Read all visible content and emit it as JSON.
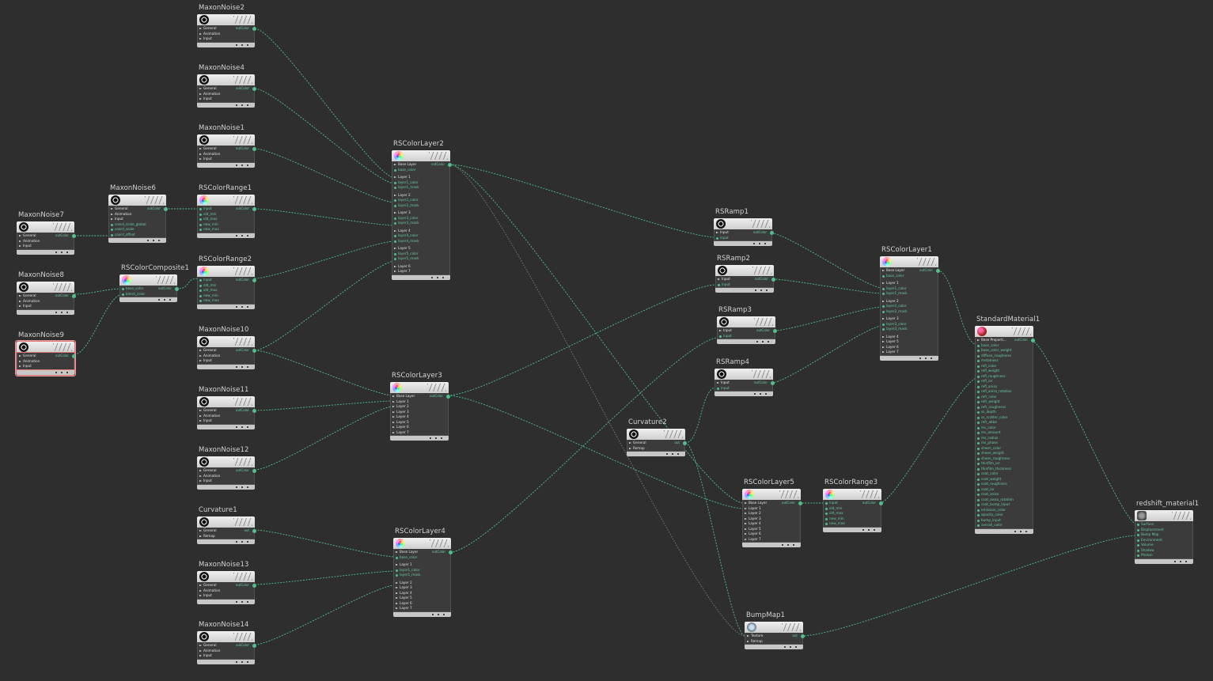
{
  "colors": {
    "wire": "#4fbf8d",
    "wire_dim": "#7a7a7a",
    "node_head": "#dcdcdc",
    "node_body": "#3b3b3b",
    "selected": "#e59a9a",
    "canvas": "#2e2e2e"
  },
  "nodes": [
    {
      "id": "MaxonNoise2",
      "title": "MaxonNoise2",
      "icon": "noise-icon",
      "rows": [
        [
          "g",
          "General"
        ],
        [
          "g",
          "Animation"
        ],
        [
          "g",
          "Input"
        ]
      ],
      "out": "outColor"
    },
    {
      "id": "MaxonNoise4",
      "title": "MaxonNoise4",
      "icon": "noise-icon",
      "rows": [
        [
          "g",
          "General"
        ],
        [
          "g",
          "Animation"
        ],
        [
          "g",
          "Input"
        ]
      ],
      "out": "outColor"
    },
    {
      "id": "MaxonNoise1",
      "title": "MaxonNoise1",
      "icon": "noise-icon",
      "rows": [
        [
          "g",
          "General"
        ],
        [
          "g",
          "Animation"
        ],
        [
          "g",
          "Input"
        ]
      ],
      "out": "outColor"
    },
    {
      "id": "MaxonNoise6",
      "title": "MaxonNoise6",
      "icon": "noise-icon",
      "rows": [
        [
          "g",
          "General"
        ],
        [
          "g",
          "Animation"
        ],
        [
          "g",
          "Input"
        ],
        [
          "p",
          "coord_scale_global"
        ],
        [
          "p",
          "coord_scale"
        ],
        [
          "p",
          "coord_offset"
        ]
      ],
      "out": "outColor"
    },
    {
      "id": "MaxonNoise7",
      "title": "MaxonNoise7",
      "icon": "noise-icon",
      "rows": [
        [
          "g",
          "General"
        ],
        [
          "g",
          "Animation"
        ],
        [
          "g",
          "Input"
        ]
      ],
      "out": "outColor"
    },
    {
      "id": "MaxonNoise8",
      "title": "MaxonNoise8",
      "icon": "noise-icon",
      "rows": [
        [
          "g",
          "General"
        ],
        [
          "g",
          "Animation"
        ],
        [
          "g",
          "Input"
        ]
      ],
      "out": "outColor"
    },
    {
      "id": "MaxonNoise9",
      "title": "MaxonNoise9",
      "icon": "noise-icon",
      "rows": [
        [
          "g",
          "General"
        ],
        [
          "g",
          "Animation"
        ],
        [
          "g",
          "Input"
        ]
      ],
      "out": "outColor",
      "selected": true
    },
    {
      "id": "RSColorRange1",
      "title": "RSColorRange1",
      "icon": "color-icon",
      "rows": [
        [
          "p",
          "input"
        ],
        [
          "p",
          "old_min"
        ],
        [
          "p",
          "old_max"
        ],
        [
          "p",
          "new_min"
        ],
        [
          "p",
          "new_max"
        ]
      ],
      "out": "outColor"
    },
    {
      "id": "RSColorComposite1",
      "title": "RSColorComposite1",
      "icon": "color-icon",
      "rows": [
        [
          "p",
          "base_color"
        ],
        [
          "p",
          "blend_color"
        ]
      ],
      "out": "outColor"
    },
    {
      "id": "RSColorRange2",
      "title": "RSColorRange2",
      "icon": "color-icon",
      "rows": [
        [
          "p",
          "input"
        ],
        [
          "p",
          "old_min"
        ],
        [
          "p",
          "old_max"
        ],
        [
          "p",
          "new_min"
        ],
        [
          "p",
          "new_max"
        ]
      ],
      "out": "outColor"
    },
    {
      "id": "MaxonNoise10",
      "title": "MaxonNoise10",
      "icon": "noise-icon",
      "rows": [
        [
          "g",
          "General"
        ],
        [
          "g",
          "Animation"
        ],
        [
          "g",
          "Input"
        ]
      ],
      "out": "outColor"
    },
    {
      "id": "MaxonNoise11",
      "title": "MaxonNoise11",
      "icon": "noise-icon",
      "rows": [
        [
          "g",
          "General"
        ],
        [
          "g",
          "Animation"
        ],
        [
          "g",
          "Input"
        ]
      ],
      "out": "outColor"
    },
    {
      "id": "MaxonNoise12",
      "title": "MaxonNoise12",
      "icon": "noise-icon",
      "rows": [
        [
          "g",
          "General"
        ],
        [
          "g",
          "Animation"
        ],
        [
          "g",
          "Input"
        ]
      ],
      "out": "outColor"
    },
    {
      "id": "Curvature1",
      "title": "Curvature1",
      "icon": "noise-icon",
      "rows": [
        [
          "g",
          "General"
        ],
        [
          "g",
          "Remap"
        ]
      ],
      "out": "out"
    },
    {
      "id": "MaxonNoise13",
      "title": "MaxonNoise13",
      "icon": "noise-icon",
      "rows": [
        [
          "g",
          "General"
        ],
        [
          "g",
          "Animation"
        ],
        [
          "g",
          "Input"
        ]
      ],
      "out": "outColor"
    },
    {
      "id": "MaxonNoise14",
      "title": "MaxonNoise14",
      "icon": "noise-icon",
      "rows": [
        [
          "g",
          "General"
        ],
        [
          "g",
          "Animation"
        ],
        [
          "g",
          "Input"
        ]
      ],
      "out": "outColor"
    },
    {
      "id": "RSColorLayer2",
      "title": "RSColorLayer2",
      "icon": "color-icon",
      "rows": [
        [
          "g",
          "Base Layer"
        ],
        [
          "p",
          "base_color"
        ],
        [
          "s",
          ""
        ],
        [
          "g",
          "Layer 1"
        ],
        [
          "p",
          "layer1_color"
        ],
        [
          "p",
          "layer1_mask"
        ],
        [
          "s",
          ""
        ],
        [
          "g",
          "Layer 2"
        ],
        [
          "p",
          "layer2_color"
        ],
        [
          "p",
          "layer2_mask"
        ],
        [
          "s",
          ""
        ],
        [
          "g",
          "Layer 3"
        ],
        [
          "p",
          "layer3_color"
        ],
        [
          "p",
          "layer3_mask"
        ],
        [
          "s",
          ""
        ],
        [
          "g",
          "Layer 4"
        ],
        [
          "p",
          "layer4_color"
        ],
        [
          "p",
          "layer4_mask"
        ],
        [
          "s",
          ""
        ],
        [
          "g",
          "Layer 5"
        ],
        [
          "p",
          "layer5_color"
        ],
        [
          "p",
          "layer5_mask"
        ],
        [
          "s",
          ""
        ],
        [
          "g",
          "Layer 6"
        ],
        [
          "g",
          "Layer 7"
        ]
      ],
      "out": "outColor"
    },
    {
      "id": "RSColorLayer3",
      "title": "RSColorLayer3",
      "icon": "color-icon",
      "rows": [
        [
          "g",
          "Base Layer"
        ],
        [
          "g",
          "Layer 1"
        ],
        [
          "g",
          "Layer 2"
        ],
        [
          "g",
          "Layer 3"
        ],
        [
          "g",
          "Layer 4"
        ],
        [
          "g",
          "Layer 5"
        ],
        [
          "g",
          "Layer 6"
        ],
        [
          "g",
          "Layer 7"
        ]
      ],
      "out": "outColor"
    },
    {
      "id": "RSColorLayer4",
      "title": "RSColorLayer4",
      "icon": "color-icon",
      "rows": [
        [
          "g",
          "Base Layer"
        ],
        [
          "p",
          "base_color"
        ],
        [
          "s",
          ""
        ],
        [
          "g",
          "Layer 1"
        ],
        [
          "p",
          "layer1_color"
        ],
        [
          "p",
          "layer1_mask"
        ],
        [
          "s",
          ""
        ],
        [
          "g",
          "Layer 2"
        ],
        [
          "g",
          "Layer 3"
        ],
        [
          "g",
          "Layer 4"
        ],
        [
          "g",
          "Layer 5"
        ],
        [
          "g",
          "Layer 6"
        ],
        [
          "g",
          "Layer 7"
        ]
      ],
      "out": "outColor"
    },
    {
      "id": "RSRamp1",
      "title": "RSRamp1",
      "icon": "noise-icon",
      "rows": [
        [
          "g",
          "Input"
        ],
        [
          "p",
          "input"
        ]
      ],
      "out": "outColor"
    },
    {
      "id": "RSRamp2",
      "title": "RSRamp2",
      "icon": "noise-icon",
      "rows": [
        [
          "g",
          "Input"
        ],
        [
          "p",
          "input"
        ]
      ],
      "out": "outColor"
    },
    {
      "id": "RSRamp3",
      "title": "RSRamp3",
      "icon": "noise-icon",
      "rows": [
        [
          "g",
          "Input"
        ],
        [
          "p",
          "input"
        ]
      ],
      "out": "outColor"
    },
    {
      "id": "RSRamp4",
      "title": "RSRamp4",
      "icon": "noise-icon",
      "rows": [
        [
          "g",
          "Input"
        ],
        [
          "p",
          "input"
        ]
      ],
      "out": "outColor"
    },
    {
      "id": "Curvature2",
      "title": "Curvature2",
      "icon": "noise-icon",
      "rows": [
        [
          "g",
          "General"
        ],
        [
          "g",
          "Remap"
        ]
      ],
      "out": "out"
    },
    {
      "id": "RSColorLayer5",
      "title": "RSColorLayer5",
      "icon": "color-icon",
      "rows": [
        [
          "g",
          "Base Layer"
        ],
        [
          "g",
          "Layer 1"
        ],
        [
          "g",
          "Layer 2"
        ],
        [
          "g",
          "Layer 3"
        ],
        [
          "g",
          "Layer 4"
        ],
        [
          "g",
          "Layer 5"
        ],
        [
          "g",
          "Layer 6"
        ],
        [
          "g",
          "Layer 7"
        ]
      ],
      "out": "outColor"
    },
    {
      "id": "RSColorRange3",
      "title": "RSColorRange3",
      "icon": "color-icon",
      "rows": [
        [
          "p",
          "input"
        ],
        [
          "p",
          "old_min"
        ],
        [
          "p",
          "old_max"
        ],
        [
          "p",
          "new_min"
        ],
        [
          "p",
          "new_max"
        ]
      ],
      "out": "outColor"
    },
    {
      "id": "BumpMap1",
      "title": "BumpMap1",
      "icon": "bump-icon",
      "rows": [
        [
          "g",
          "Texture"
        ],
        [
          "g",
          "Remap"
        ]
      ],
      "out": "out"
    },
    {
      "id": "RSColorLayer1",
      "title": "RSColorLayer1",
      "icon": "color-icon",
      "rows": [
        [
          "g",
          "Base Layer"
        ],
        [
          "p",
          "base_color"
        ],
        [
          "s",
          ""
        ],
        [
          "g",
          "Layer 1"
        ],
        [
          "p",
          "layer1_color"
        ],
        [
          "p",
          "layer1_mask"
        ],
        [
          "s",
          ""
        ],
        [
          "g",
          "Layer 2"
        ],
        [
          "p",
          "layer2_color"
        ],
        [
          "p",
          "layer2_mask"
        ],
        [
          "s",
          ""
        ],
        [
          "g",
          "Layer 3"
        ],
        [
          "p",
          "layer3_color"
        ],
        [
          "p",
          "layer3_mask"
        ],
        [
          "s",
          ""
        ],
        [
          "g",
          "Layer 4"
        ],
        [
          "g",
          "Layer 5"
        ],
        [
          "g",
          "Layer 6"
        ],
        [
          "g",
          "Layer 7"
        ]
      ],
      "out": "outColor"
    },
    {
      "id": "StandardMaterial1",
      "title": "StandardMaterial1",
      "icon": "material-icon",
      "rows": [
        [
          "g",
          "Base Properti..."
        ],
        [
          "p",
          "base_color"
        ],
        [
          "p",
          "base_color_weight"
        ],
        [
          "p",
          "diffuse_roughness"
        ],
        [
          "p",
          "metalness"
        ],
        [
          "p",
          "refl_color"
        ],
        [
          "p",
          "refl_weight"
        ],
        [
          "p",
          "refl_roughness"
        ],
        [
          "p",
          "refl_ior"
        ],
        [
          "p",
          "refl_aniso"
        ],
        [
          "p",
          "refl_aniso_rotation"
        ],
        [
          "p",
          "refr_color"
        ],
        [
          "p",
          "refr_weight"
        ],
        [
          "p",
          "refr_roughness"
        ],
        [
          "p",
          "ss_depth"
        ],
        [
          "p",
          "ss_scatter_color"
        ],
        [
          "p",
          "refr_abbe"
        ],
        [
          "p",
          "ms_color"
        ],
        [
          "p",
          "ms_amount"
        ],
        [
          "p",
          "ms_radius"
        ],
        [
          "p",
          "ms_phase"
        ],
        [
          "p",
          "sheen_color"
        ],
        [
          "p",
          "sheen_weight"
        ],
        [
          "p",
          "sheen_roughness"
        ],
        [
          "p",
          "thinfilm_ior"
        ],
        [
          "p",
          "thinfilm_thickness"
        ],
        [
          "p",
          "coat_color"
        ],
        [
          "p",
          "coat_weight"
        ],
        [
          "p",
          "coat_roughness"
        ],
        [
          "p",
          "coat_ior"
        ],
        [
          "p",
          "coat_aniso"
        ],
        [
          "p",
          "coat_aniso_rotation"
        ],
        [
          "p",
          "coat_bump_input"
        ],
        [
          "p",
          "emission_color"
        ],
        [
          "p",
          "opacity_color"
        ],
        [
          "p",
          "bump_input"
        ],
        [
          "p",
          "overall_color"
        ]
      ],
      "out": "outColor"
    },
    {
      "id": "redshift_material1",
      "title": "redshift_material1",
      "icon": "rs-icon",
      "rows": [
        [
          "p",
          "Surface"
        ],
        [
          "p",
          "Displacement"
        ],
        [
          "p",
          "Bump Map"
        ],
        [
          "p",
          "Environment"
        ],
        [
          "p",
          "Volume"
        ],
        [
          "p",
          "Shadow"
        ],
        [
          "p",
          "Photon"
        ]
      ],
      "out": ""
    }
  ]
}
